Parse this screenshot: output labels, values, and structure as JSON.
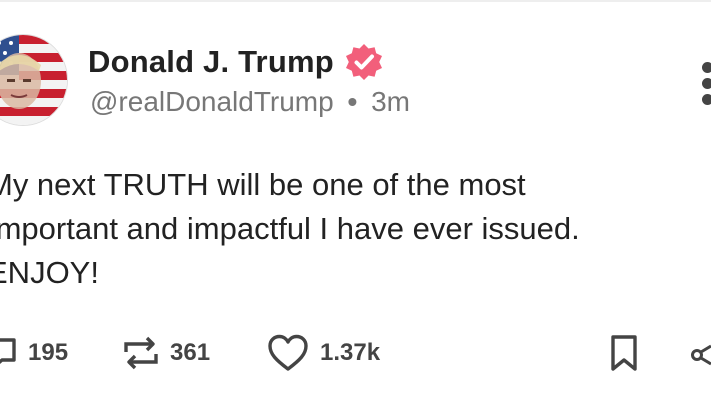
{
  "post": {
    "author_name": "Donald J. Trump",
    "handle": "@realDonaldTrump",
    "separator": "•",
    "time_ago": "3m",
    "body_lines": [
      "My next TRUTH will be one of the most",
      "Important and impactful I have ever issued.",
      "ENJOY!"
    ]
  },
  "icons": {
    "verified": "verified-badge-icon",
    "more": "more-options-icon",
    "reply": "reply-icon",
    "repost": "retruth-icon",
    "like": "heart-icon",
    "save": "bookmark-icon",
    "share": "share-icon"
  },
  "actions": {
    "replies": "195",
    "reposts": "361",
    "likes": "1.37k"
  },
  "colors": {
    "verified_badge": "#f25f7b",
    "text": "#222222",
    "meta": "#777777",
    "icons": "#444444"
  }
}
